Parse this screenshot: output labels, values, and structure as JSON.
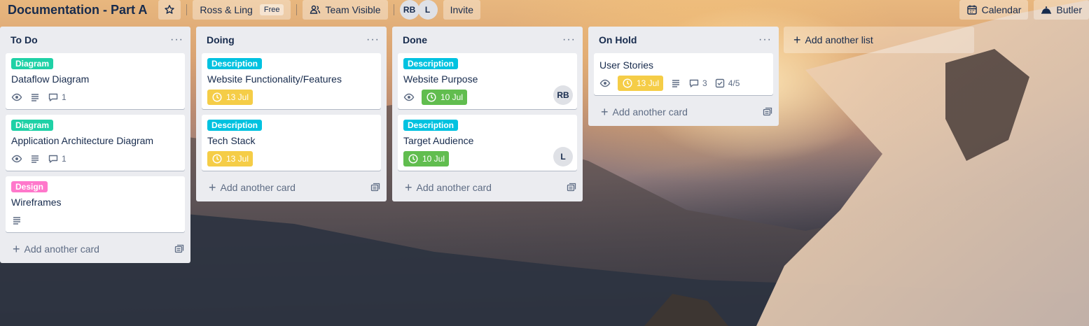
{
  "header": {
    "board_title": "Documentation - Part A",
    "star_icon": "star-icon",
    "workspace": "Ross & Ling",
    "workspace_plan": "Free",
    "visibility": "Team Visible",
    "members": [
      "RB",
      "L"
    ],
    "invite_label": "Invite",
    "calendar_label": "Calendar",
    "butler_label": "Butler"
  },
  "lists": [
    {
      "title": "To Do",
      "cards": [
        {
          "label": "Diagram",
          "label_color": "#1fd1a6",
          "title": "Dataflow Diagram",
          "comments": "1"
        },
        {
          "label": "Diagram",
          "label_color": "#1fd1a6",
          "title": "Application Architecture Diagram",
          "comments": "1"
        },
        {
          "label": "Design",
          "label_color": "#ff78cb",
          "title": "Wireframes"
        }
      ],
      "add_card_label": "Add another card"
    },
    {
      "title": "Doing",
      "cards": [
        {
          "label": "Description",
          "label_color": "#00c2e0",
          "title": "Website Functionality/Features",
          "due": "13 Jul",
          "due_color": "#f5cd47"
        },
        {
          "label": "Description",
          "label_color": "#00c2e0",
          "title": "Tech Stack",
          "due": "13 Jul",
          "due_color": "#f5cd47"
        }
      ],
      "add_card_label": "Add another card"
    },
    {
      "title": "Done",
      "cards": [
        {
          "label": "Description",
          "label_color": "#00c2e0",
          "title": "Website Purpose",
          "due": "10 Jul",
          "due_color": "#61bd4f",
          "member": "RB"
        },
        {
          "label": "Description",
          "label_color": "#00c2e0",
          "title": "Target Audience",
          "due": "10 Jul",
          "due_color": "#61bd4f",
          "member": "L"
        }
      ],
      "add_card_label": "Add another card"
    },
    {
      "title": "On Hold",
      "cards": [
        {
          "title": "User Stories",
          "due": "13 Jul",
          "due_color": "#f5cd47",
          "comments": "3",
          "checklist": "4/5"
        }
      ],
      "add_card_label": "Add another card"
    }
  ],
  "add_list_label": "Add another list",
  "list_menu": "···"
}
